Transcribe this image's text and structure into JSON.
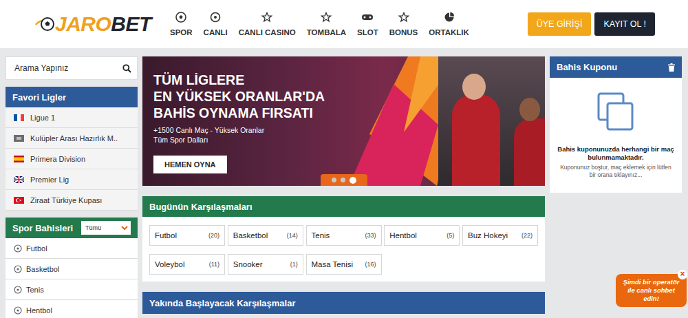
{
  "logo": {
    "part1": "JARO",
    "part2": "BET"
  },
  "nav": [
    {
      "label": "SPOR",
      "kind": "ball"
    },
    {
      "label": "CANLI",
      "kind": "clock"
    },
    {
      "label": "CANLI CASINO",
      "kind": "star"
    },
    {
      "label": "TOMBALA",
      "kind": "star"
    },
    {
      "label": "SLOT",
      "kind": "gamepad"
    },
    {
      "label": "BONUS",
      "kind": "star"
    },
    {
      "label": "ORTAKLIK",
      "kind": "pie"
    }
  ],
  "auth": {
    "login": "ÜYE GİRİŞİ",
    "register": "KAYIT OL !"
  },
  "search": {
    "placeholder": "Arama Yapınız"
  },
  "favorites": {
    "title": "Favori Ligler",
    "items": [
      {
        "label": "Ligue 1",
        "kind": "fr"
      },
      {
        "label": "Kulüpler Arası Hazırlık M..",
        "kind": "club"
      },
      {
        "label": "Primera Division",
        "kind": "es"
      },
      {
        "label": "Premier Lig",
        "kind": "gb"
      },
      {
        "label": "Ziraat Türkiye Kupası",
        "kind": "tr"
      }
    ]
  },
  "sports": {
    "title": "Spor Bahisleri",
    "filter": "Tümü",
    "items": [
      "Futbol",
      "Basketbol",
      "Tenis",
      "Hentbol"
    ]
  },
  "banner": {
    "lines": [
      "TÜM LİGLERE",
      "EN YÜKSEK ORANLAR'DA",
      "BAHİS OYNAMA FIRSATI"
    ],
    "subtitle": "+1500 Canlı Maç - Yüksek Oranlar",
    "subtitle2": "Tüm Spor Dalları",
    "button": "HEMEN OYNA",
    "dots": [
      {
        "selected": false
      },
      {
        "selected": false
      },
      {
        "selected": true
      }
    ]
  },
  "today": {
    "title": "Bugünün Karşılaşmaları",
    "items": [
      {
        "label": "Futbol",
        "count": "(20)"
      },
      {
        "label": "Basketbol",
        "count": "(14)"
      },
      {
        "label": "Tenis",
        "count": "(33)"
      },
      {
        "label": "Hentbol",
        "count": "(5)"
      },
      {
        "label": "Buz Hokeyi",
        "count": "(22)"
      },
      {
        "label": "Voleybol",
        "count": "(11)"
      },
      {
        "label": "Snooker",
        "count": "(1)"
      },
      {
        "label": "Masa Tenisi",
        "count": "(16)"
      }
    ]
  },
  "upcoming": {
    "title": "Yakında Başlayacak Karşılaşmalar"
  },
  "coupon": {
    "title": "Bahis Kuponu",
    "empty": "Bahis kuponunuzda herhangi bir maç bulunmamaktadır.",
    "hint": "Kuponunuz boştur, maç eklemek için lütfen bir orana tıklayınız..."
  },
  "chat": {
    "text": "Şimdi bir operatör ile canlı sohbet edin!",
    "close": "×"
  }
}
